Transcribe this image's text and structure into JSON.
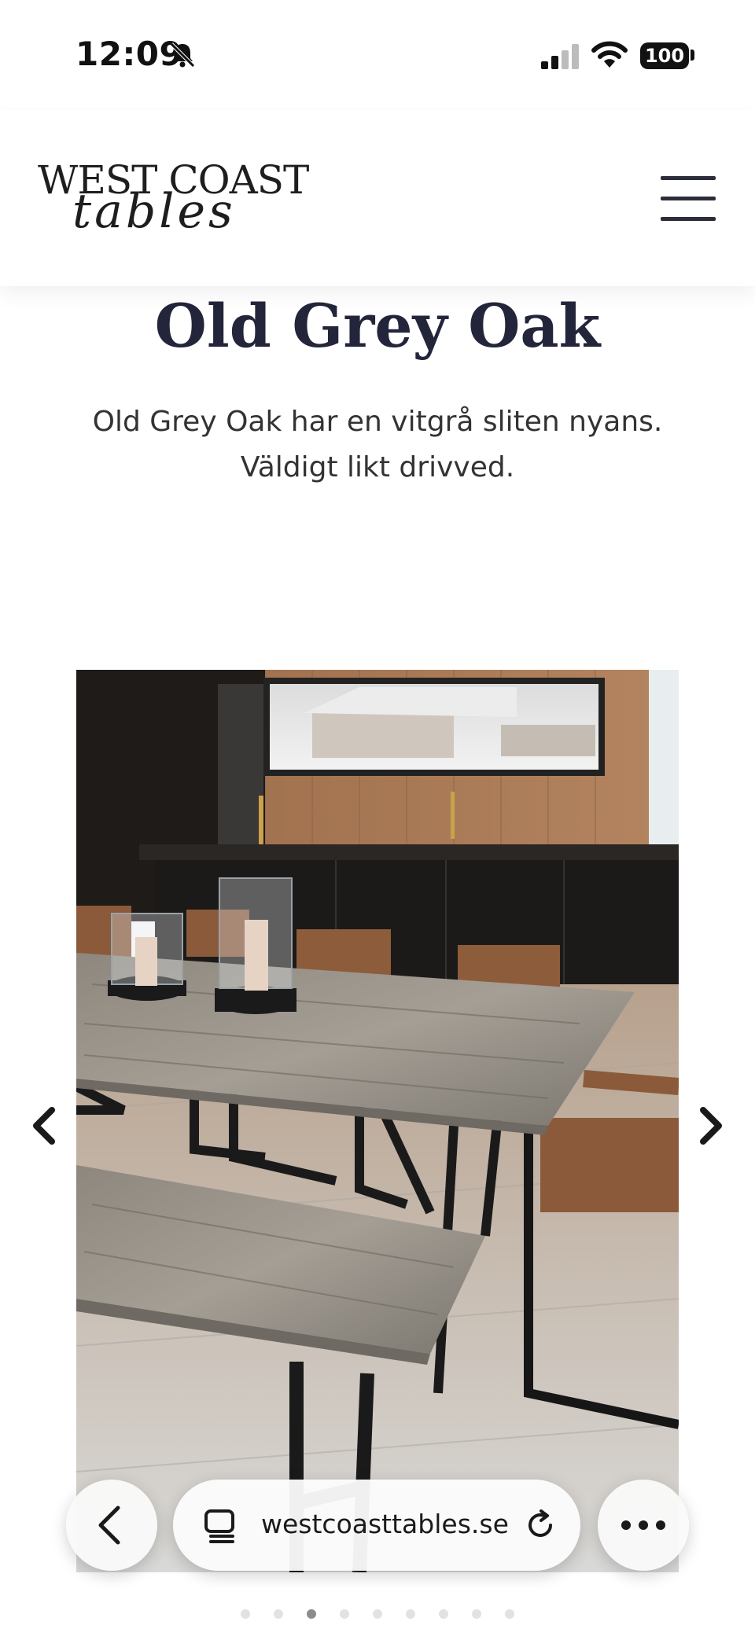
{
  "status_bar": {
    "time": "12:09",
    "battery": "100",
    "icons": [
      "bell-slash-icon",
      "cellular-signal-icon",
      "wifi-icon",
      "battery-icon"
    ]
  },
  "header": {
    "logo_line1": "WEST COAST",
    "logo_line2": "tables",
    "menu_icon": "hamburger-menu-icon"
  },
  "content": {
    "title": "Old Grey Oak",
    "description": "Old Grey Oak har en vitgrå sliten nyans. Väldigt likt drivved."
  },
  "carousel": {
    "slide_count": 9,
    "active_index": 2,
    "prev_icon": "chevron-left-icon",
    "next_icon": "chevron-right-icon"
  },
  "browser": {
    "url": "westcoasttables.se",
    "back_icon": "chevron-left-icon",
    "tabs_icon": "tabs-icon",
    "reload_icon": "reload-icon",
    "more_icon": "more-icon"
  },
  "colors": {
    "title": "#23253a",
    "text": "#333333",
    "dot_active": "#8c8c8c",
    "dot_inactive": "#e2e2e2"
  }
}
